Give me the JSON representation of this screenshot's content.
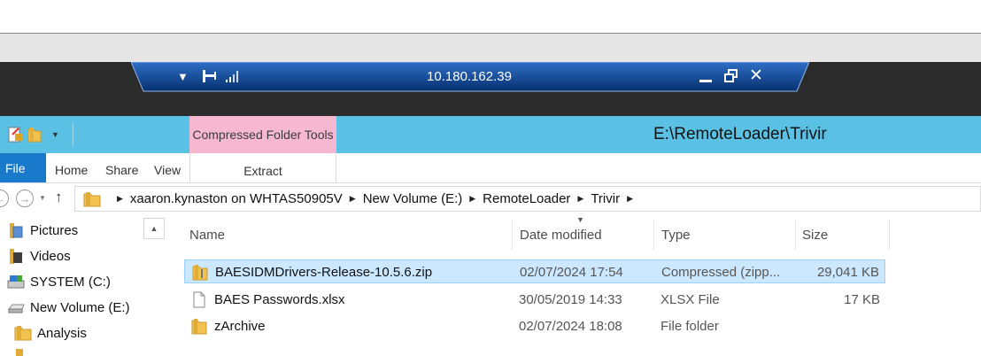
{
  "rdp": {
    "title": "10.180.162.39",
    "pin_icon": "pin-icon",
    "signal_icon": "signal-icon"
  },
  "ribbon": {
    "contextual_tab": "Compressed Folder Tools",
    "window_title": "E:\\RemoteLoader\\Trivir",
    "tabs": {
      "file": "File",
      "home": "Home",
      "share": "Share",
      "view": "View",
      "extract": "Extract"
    }
  },
  "breadcrumb": [
    "xaaron.kynaston on WHTAS50905V",
    "New Volume (E:)",
    "RemoteLoader",
    "Trivir"
  ],
  "nav": [
    {
      "label": "Pictures",
      "icon": "pictures-icon"
    },
    {
      "label": "Videos",
      "icon": "videos-icon"
    },
    {
      "label": "SYSTEM (C:)",
      "icon": "system-drive-icon"
    },
    {
      "label": "New Volume (E:)",
      "icon": "drive-icon"
    },
    {
      "label": "Analysis",
      "icon": "folder-icon"
    }
  ],
  "columns": {
    "name": "Name",
    "date": "Date modified",
    "type": "Type",
    "size": "Size"
  },
  "files": [
    {
      "name": "BAESIDMDrivers-Release-10.5.6.zip",
      "date": "02/07/2024 17:54",
      "type": "Compressed (zipp...",
      "size": "29,041 KB",
      "icon": "zip-folder-icon",
      "selected": true
    },
    {
      "name": "BAES Passwords.xlsx",
      "date": "30/05/2019 14:33",
      "type": "XLSX File",
      "size": "17 KB",
      "icon": "file-icon",
      "selected": false
    },
    {
      "name": "zArchive",
      "date": "02/07/2024 18:08",
      "type": "File folder",
      "size": "",
      "icon": "folder-icon",
      "selected": false
    }
  ],
  "colors": {
    "ribbon_blue": "#5bc1e4",
    "context_pink": "#f6b8d1",
    "file_tab": "#1979ca",
    "rdp_bar": "#0b3f8f",
    "selection": "#cce8ff"
  }
}
